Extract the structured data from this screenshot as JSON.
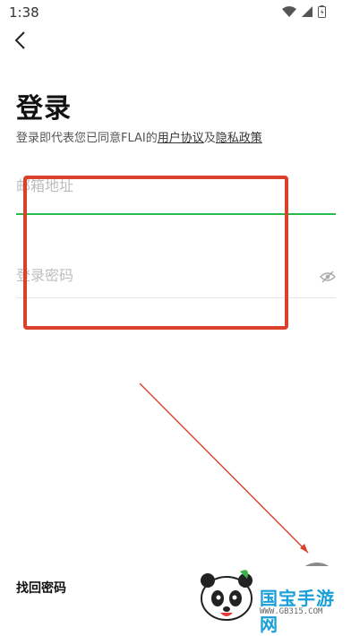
{
  "status": {
    "time": "1:38"
  },
  "page": {
    "title": "登录",
    "agreement": {
      "prefix": "登录即代表您已同意FLAI的",
      "terms_link": "用户协议",
      "conjunction": "及",
      "privacy_link": "隐私政策"
    }
  },
  "form": {
    "email_placeholder": "邮箱地址",
    "password_placeholder": "登录密码"
  },
  "footer": {
    "forgot_label": "找回密码"
  },
  "watermark": {
    "brand": "国宝手游网",
    "url": "WWW.GB315.COM"
  },
  "colors": {
    "focus_line": "#27b94a",
    "annotation": "#d9412b"
  },
  "icons": [
    "back-arrow-icon",
    "wifi-icon",
    "signal-icon",
    "battery-icon",
    "eye-hidden-icon",
    "panda-logo-icon"
  ]
}
